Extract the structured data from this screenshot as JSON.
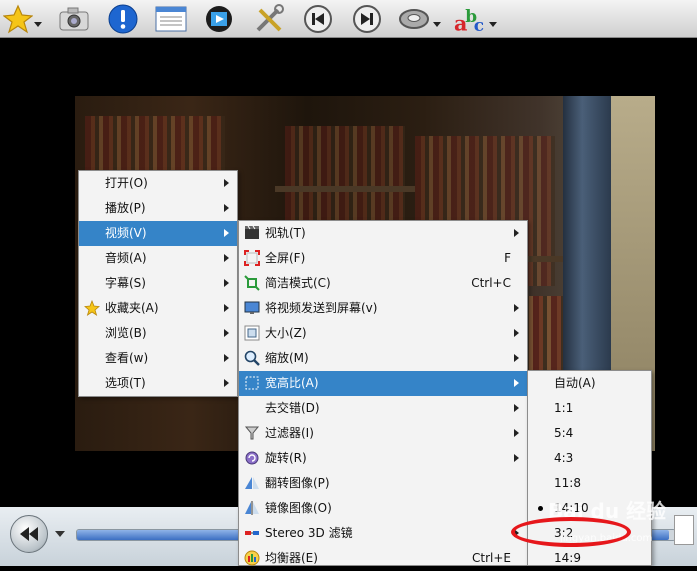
{
  "menu_main": [
    {
      "label": "打开(O)",
      "icon": "",
      "submenu": true
    },
    {
      "label": "播放(P)",
      "icon": "",
      "submenu": true
    },
    {
      "label": "视频(V)",
      "icon": "",
      "submenu": true,
      "selected": true
    },
    {
      "label": "音频(A)",
      "icon": "",
      "submenu": true
    },
    {
      "label": "字幕(S)",
      "icon": "",
      "submenu": true
    },
    {
      "label": "收藏夹(A)",
      "icon": "star-icon",
      "submenu": true
    },
    {
      "label": "浏览(B)",
      "icon": "",
      "submenu": true
    },
    {
      "label": "查看(w)",
      "icon": "",
      "submenu": true
    },
    {
      "label": "选项(T)",
      "icon": "",
      "submenu": true
    }
  ],
  "menu_video": [
    {
      "label": "视轨(T)",
      "shortcut": "",
      "icon": "film-icon",
      "submenu": true
    },
    {
      "label": "全屏(F)",
      "shortcut": "F",
      "icon": "fullscreen-icon",
      "submenu": false
    },
    {
      "label": "简洁模式(C)",
      "shortcut": "Ctrl+C",
      "icon": "compact-icon",
      "submenu": false
    },
    {
      "label": "将视频发送到屏幕(v)",
      "shortcut": "",
      "icon": "monitor-icon",
      "submenu": true
    },
    {
      "label": "大小(Z)",
      "shortcut": "",
      "icon": "size-icon",
      "submenu": true
    },
    {
      "label": "缩放(M)",
      "shortcut": "",
      "icon": "zoom-icon",
      "submenu": true
    },
    {
      "label": "宽高比(A)",
      "shortcut": "",
      "icon": "aspect-icon",
      "submenu": true,
      "selected": true
    },
    {
      "label": "去交错(D)",
      "shortcut": "",
      "icon": "",
      "submenu": true
    },
    {
      "label": "过滤器(I)",
      "shortcut": "",
      "icon": "filter-icon",
      "submenu": true
    },
    {
      "label": "旋转(R)",
      "shortcut": "",
      "icon": "rotate-icon",
      "submenu": true
    },
    {
      "label": "翻转图像(P)",
      "shortcut": "",
      "icon": "flip-icon",
      "submenu": false
    },
    {
      "label": "镜像图像(O)",
      "shortcut": "",
      "icon": "mirror-icon",
      "submenu": false
    },
    {
      "label": "Stereo 3D 滤镜",
      "shortcut": "",
      "icon": "stereo-3d-icon",
      "submenu": true
    },
    {
      "label": "均衡器(E)",
      "shortcut": "Ctrl+E",
      "icon": "equalizer-icon",
      "submenu": false
    }
  ],
  "menu_aspect": [
    {
      "label": "自动(A)",
      "checked": false
    },
    {
      "label": "1:1",
      "checked": false
    },
    {
      "label": "5:4",
      "checked": false
    },
    {
      "label": "4:3",
      "checked": false
    },
    {
      "label": "11:8",
      "checked": false
    },
    {
      "label": "14:10",
      "checked": true
    },
    {
      "label": "3:2",
      "checked": false
    },
    {
      "label": "14:9",
      "checked": false
    }
  ],
  "toolbar_icons": [
    "favorites-star-icon",
    "screenshot-camera-icon",
    "info-icon",
    "playlist-icon",
    "video-clip-icon",
    "tools-icon",
    "previous-icon",
    "next-icon",
    "audio-disc-icon",
    "subtitle-abc-icon"
  ],
  "seek_progress": 0.99,
  "watermark": "Bai du 经验",
  "watermark_url": "jingyan.baidu.com",
  "colors": {
    "highlight": "#3584c8",
    "annotation": "#e6171b"
  }
}
